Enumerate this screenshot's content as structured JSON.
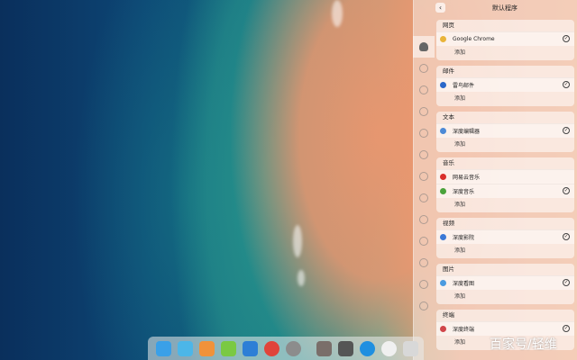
{
  "panel": {
    "back_label": "‹",
    "title": "默认程序",
    "add_label": "添加",
    "check_mark": "✓"
  },
  "categories": [
    {
      "title": "网页",
      "apps": [
        {
          "name": "Google Chrome",
          "icon": "chrome-icon",
          "color": "#e9b43a",
          "selected": true
        }
      ]
    },
    {
      "title": "邮件",
      "apps": [
        {
          "name": "雷鸟邮件",
          "icon": "thunderbird-icon",
          "color": "#2a67c9",
          "selected": true
        }
      ]
    },
    {
      "title": "文本",
      "apps": [
        {
          "name": "深度编辑器",
          "icon": "text-editor-icon",
          "color": "#4d8ad6",
          "selected": true
        }
      ]
    },
    {
      "title": "音乐",
      "apps": [
        {
          "name": "网易云音乐",
          "icon": "netease-music-icon",
          "color": "#d9302c",
          "selected": false
        },
        {
          "name": "深度音乐",
          "icon": "deepin-music-icon",
          "color": "#4aa23a",
          "selected": true
        }
      ]
    },
    {
      "title": "视频",
      "apps": [
        {
          "name": "深度影院",
          "icon": "deepin-movie-icon",
          "color": "#3a78d6",
          "selected": true
        }
      ]
    },
    {
      "title": "图片",
      "apps": [
        {
          "name": "深度看图",
          "icon": "image-viewer-icon",
          "color": "#4a9be0",
          "selected": true
        }
      ]
    },
    {
      "title": "终端",
      "apps": [
        {
          "name": "深度终端",
          "icon": "terminal-icon",
          "color": "#d0464a",
          "selected": true
        }
      ]
    }
  ],
  "side_icons": [
    "account-icon",
    "cloud-icon",
    "display-icon",
    "calendar-icon",
    "personalization-icon",
    "network-icon",
    "sound-icon",
    "time-icon",
    "power-icon",
    "mouse-icon",
    "keyboard-icon",
    "update-icon",
    "info-icon"
  ],
  "dock_apps": [
    {
      "name": "launcher-icon",
      "color": "#3aa0e8"
    },
    {
      "name": "file-manager-icon",
      "color": "#4cb6e8"
    },
    {
      "name": "app-store-icon",
      "color": "#f0923a"
    },
    {
      "name": "music-icon",
      "color": "#7ac943"
    },
    {
      "name": "movie-icon",
      "color": "#2d7fd6"
    },
    {
      "name": "chrome-icon",
      "color": "#e0443a"
    },
    {
      "name": "settings-icon",
      "color": "#8c8c8c"
    },
    {
      "name": "show-more-icon",
      "color": "#7a6e6a"
    },
    {
      "name": "keyboard-icon",
      "color": "#555555"
    },
    {
      "name": "power-icon",
      "color": "#1f8fe0"
    },
    {
      "name": "clock-icon",
      "color": "#f0f0f0"
    },
    {
      "name": "trash-icon",
      "color": "#d8d8d8"
    }
  ],
  "watermark": "百家号/轻维"
}
